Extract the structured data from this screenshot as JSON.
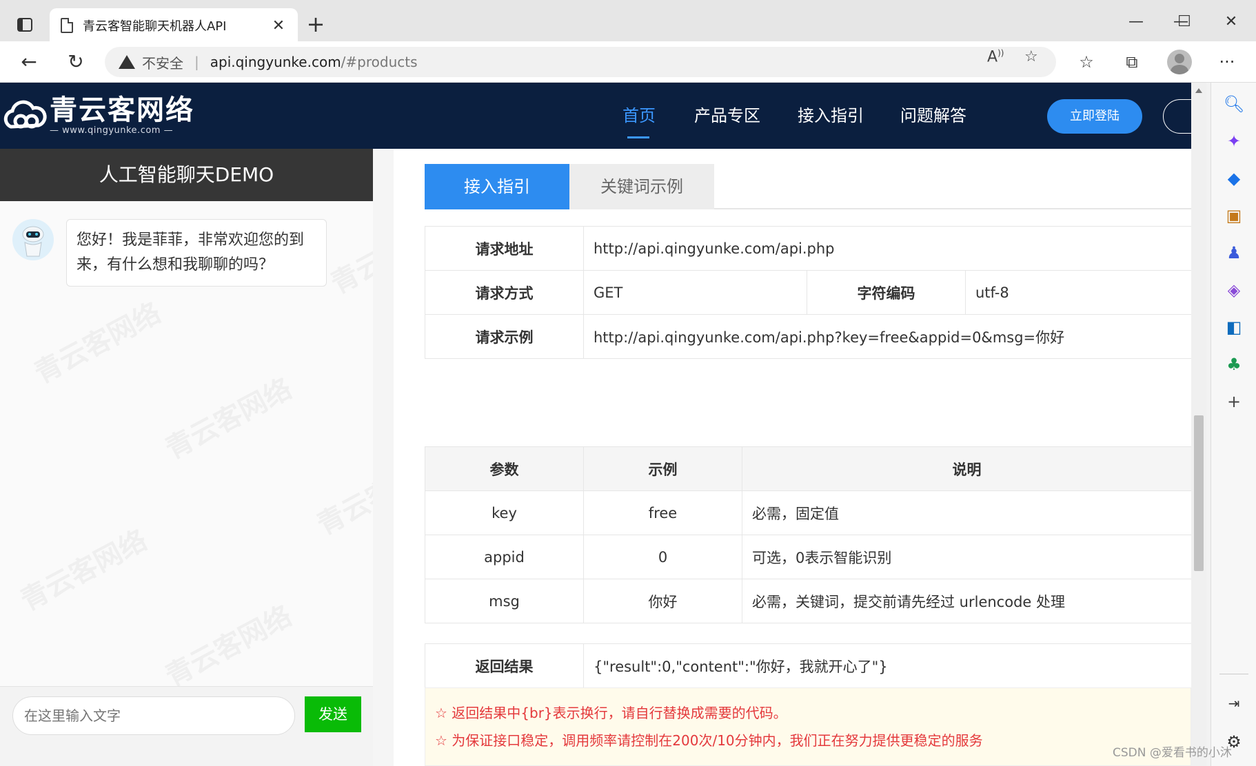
{
  "browser": {
    "tab_title": "青云客智能聊天机器人API",
    "address_warning": "不安全",
    "address_host": "api.qingyunke.com",
    "address_path": "/#products"
  },
  "site": {
    "logo_name": "青云客网络",
    "logo_url": "— www.qingyunke.com —",
    "nav": [
      "首页",
      "产品专区",
      "接入指引",
      "问题解答"
    ],
    "login_label": "立即登陆"
  },
  "chat": {
    "title": "人工智能聊天DEMO",
    "watermark": "青云客网络",
    "bot_message": "您好！我是菲菲，非常欢迎您的到来，有什么想和我聊聊的吗？",
    "input_placeholder": "在这里输入文字",
    "send_label": "发送"
  },
  "content": {
    "tabs": [
      "接入指引",
      "关键词示例"
    ],
    "request": {
      "address_label": "请求地址",
      "address_value": "http://api.qingyunke.com/api.php",
      "method_label": "请求方式",
      "method_value": "GET",
      "charset_label": "字符编码",
      "charset_value": "utf-8",
      "example_label": "请求示例",
      "example_value": "http://api.qingyunke.com/api.php?key=free&appid=0&msg=你好"
    },
    "params": {
      "headers": [
        "参数",
        "示例",
        "说明"
      ],
      "rows": [
        [
          "key",
          "free",
          "必需，固定值"
        ],
        [
          "appid",
          "0",
          "可选，0表示智能识别"
        ],
        [
          "msg",
          "你好",
          "必需，关键词，提交前请先经过 urlencode 处理"
        ]
      ]
    },
    "result": {
      "label": "返回结果",
      "value": "{\"result\":0,\"content\":\"你好，我就开心了\"}"
    },
    "notices": [
      "☆ 返回结果中{br}表示换行，请自行替换成需要的代码。",
      "☆ 为保证接口稳定，调用频率请控制在200次/10分钟内，我们正在努力提供更稳定的服务"
    ]
  },
  "footer_watermark": "CSDN @爱看书的小沐",
  "colors": {
    "header_bg": "#0b1f3f",
    "accent": "#2d8cf0",
    "send_green": "#09bb07",
    "notice_red": "#e4393c"
  },
  "icons": [
    "sidebar-toggle-icon",
    "document-icon",
    "close-icon",
    "plus-icon",
    "minimize-icon",
    "maximize-icon",
    "window-close-icon",
    "back-arrow-icon",
    "refresh-icon",
    "warning-icon",
    "read-aloud-icon",
    "add-favorite-icon",
    "favorites-icon",
    "collections-icon",
    "profile-icon",
    "more-icon",
    "search-icon",
    "copilot-icon",
    "shopping-icon",
    "tools-icon",
    "games-icon",
    "microsoft365-icon",
    "outlook-icon",
    "drop-icon",
    "add-icon",
    "sidebar-hide-icon",
    "settings-icon"
  ]
}
